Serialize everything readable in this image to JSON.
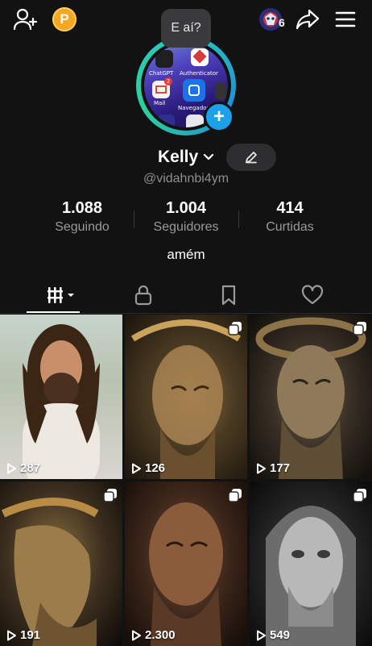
{
  "header": {
    "coin_label": "P",
    "bubble_text": "E aí?",
    "notif_count": "6"
  },
  "profile": {
    "name": "Kelly",
    "handle": "@vidahnbi4ym",
    "bio": "amém",
    "avatar_apps": [
      "ChatGPT",
      "Authenticator",
      "Mail",
      "Navegador"
    ],
    "avatar_badge_count": "2"
  },
  "stats": [
    {
      "value": "1.088",
      "label": "Seguindo"
    },
    {
      "value": "1.004",
      "label": "Seguidores"
    },
    {
      "value": "414",
      "label": "Curtidas"
    }
  ],
  "tabs": [
    {
      "name": "videos",
      "icon": "grid-icon",
      "selected": true
    },
    {
      "name": "private",
      "icon": "lock-icon"
    },
    {
      "name": "saved",
      "icon": "bookmark-icon"
    },
    {
      "name": "liked",
      "icon": "heart-icon"
    }
  ],
  "videos": [
    {
      "views": "287",
      "multi": false
    },
    {
      "views": "126",
      "multi": true
    },
    {
      "views": "177",
      "multi": true
    },
    {
      "views": "191",
      "multi": true
    },
    {
      "views": "2.300",
      "multi": true
    },
    {
      "views": "549",
      "multi": true
    }
  ],
  "colors": {
    "background": "#121212",
    "accent_ring": "#29c7c1",
    "plus_badge": "#1ca1e9",
    "coin": "#f5a623"
  }
}
